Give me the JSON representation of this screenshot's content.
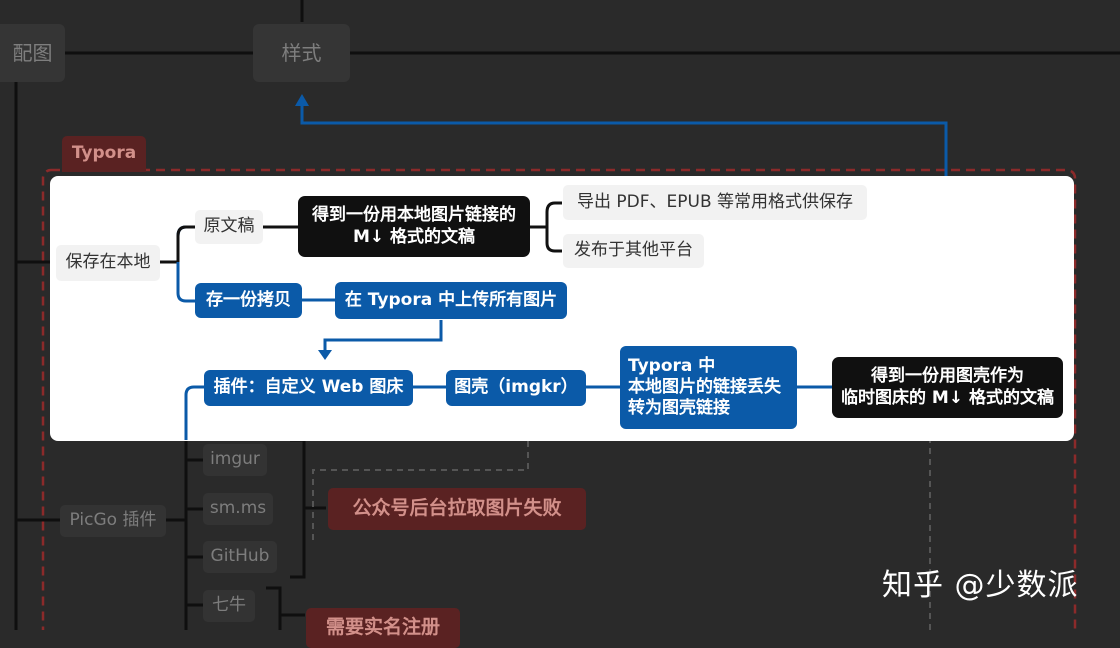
{
  "top_nodes": {
    "left_partial": "配图",
    "style": "样式"
  },
  "typora_tag": "Typora",
  "panel": {
    "save_local": "保存在本地",
    "original_doc": "原文稿",
    "local_md_line1": "得到一份用本地图片链接的",
    "local_md_line2": "M↓ 格式的文稿",
    "export": "导出 PDF、EPUB 等常用格式供保存",
    "publish": "发布于其他平台",
    "copy": "存一份拷贝",
    "upload": "在 Typora 中上传所有图片",
    "plugin": "插件：自定义 Web 图床",
    "imgkr": "图壳（imgkr）",
    "typora_line1": "Typora 中",
    "typora_line2": "本地图片的链接丢失",
    "typora_line3": "转为图壳链接",
    "result_line1": "得到一份用图壳作为",
    "result_line2": "临时图床的 M↓ 格式的文稿"
  },
  "lower": {
    "picgo": "PicGo 插件",
    "imgur": "imgur",
    "smms": "sm.ms",
    "github": "GitHub",
    "qiniu": "七牛",
    "wechat_fail": "公众号后台拉取图片失败",
    "need_register": "需要实名注册"
  },
  "watermark": "知乎 @少数派",
  "colors": {
    "blue": "#0b5aa8",
    "black": "#101010",
    "red_dash": "#8c2a2a"
  }
}
